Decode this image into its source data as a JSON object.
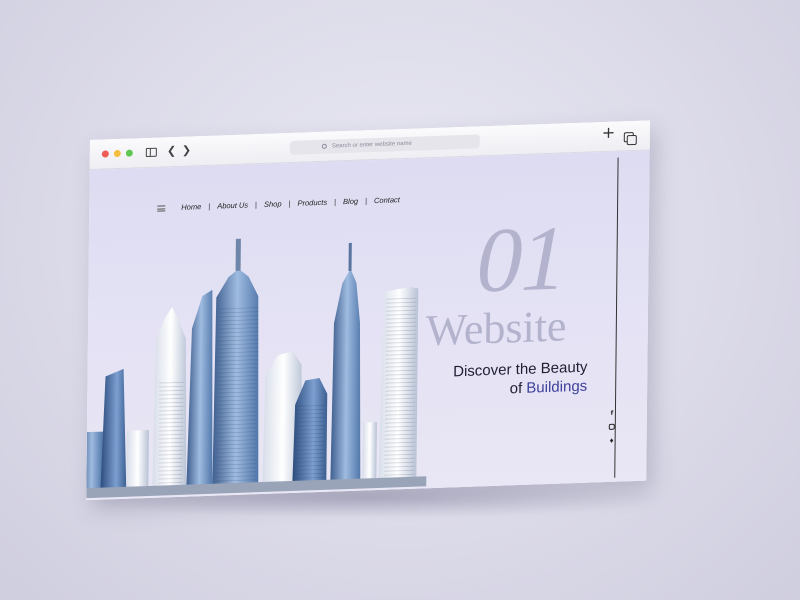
{
  "browser": {
    "address_placeholder": "Search or enter website name",
    "plus_label": "+"
  },
  "nav": {
    "items": [
      {
        "label": "Home"
      },
      {
        "label": "About Us"
      },
      {
        "label": "Shop"
      },
      {
        "label": "Products"
      },
      {
        "label": "Blog"
      },
      {
        "label": "Contact"
      }
    ],
    "separator": "|"
  },
  "hero": {
    "number": "01",
    "word": "Website",
    "tagline_line1": "Discover the Beauty",
    "tagline_line2_prefix": "of ",
    "tagline_line2_accent": "Buildings"
  },
  "social": {
    "facebook_glyph": "f",
    "twitter_glyph": "♦"
  },
  "colors": {
    "accent": "#3c3f9a",
    "big_text": "#b4b3cd",
    "background": "#dedcf2"
  }
}
